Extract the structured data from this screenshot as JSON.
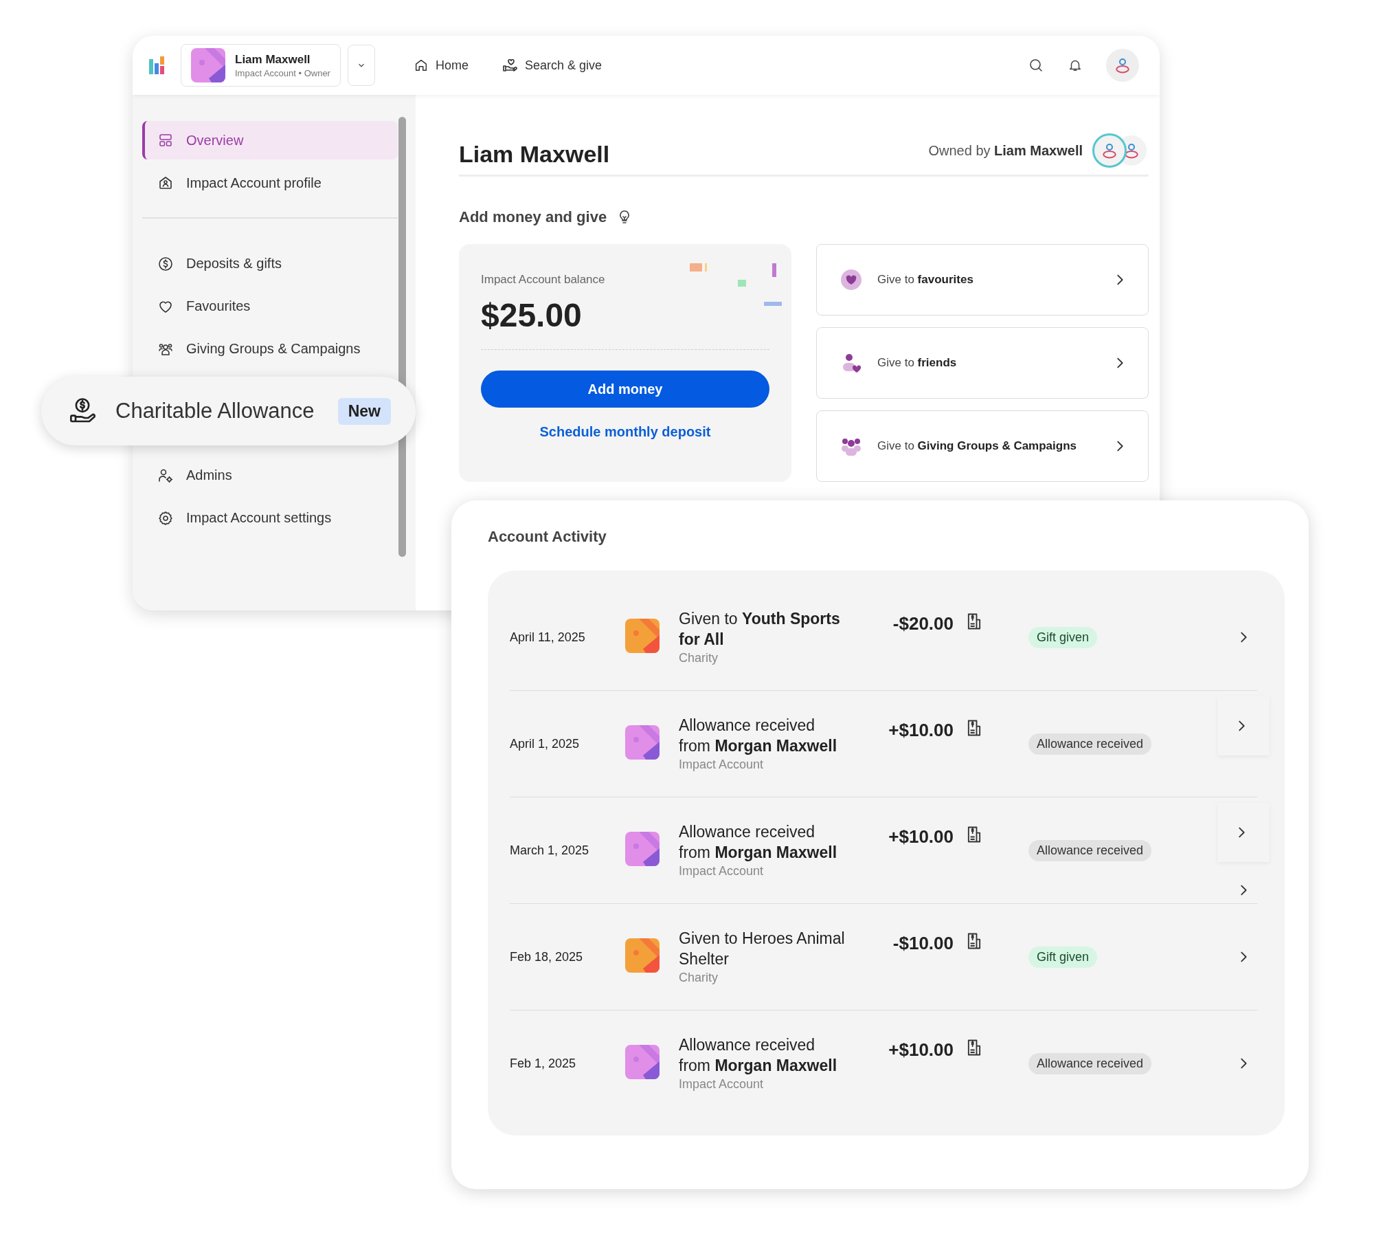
{
  "top_bar": {
    "account": {
      "name": "Liam Maxwell",
      "subtitle": "Impact Account • Owner"
    },
    "nav": [
      {
        "label": "Home"
      },
      {
        "label": "Search & give"
      }
    ]
  },
  "sidebar": {
    "sections": [
      {
        "items": [
          {
            "label": "Overview",
            "selected": true
          },
          {
            "label": "Impact Account profile",
            "selected": false
          }
        ]
      },
      {
        "divider_above": true,
        "items": [
          {
            "label": "Deposits & gifts",
            "selected": false
          },
          {
            "label": "Favourites",
            "selected": false
          },
          {
            "label": "Giving Groups & Campaigns",
            "selected": false
          }
        ]
      },
      {
        "divider_above": false,
        "items": [
          {
            "label": "Admins",
            "selected": false
          },
          {
            "label": "Impact Account settings",
            "selected": false
          }
        ]
      }
    ]
  },
  "highlight": {
    "label": "Charitable Allowance",
    "badge": "New"
  },
  "page": {
    "title": "Liam Maxwell",
    "owner": "Owned by **Liam Maxwell**",
    "section_title": "Add money and give",
    "balance": {
      "label": "Impact Account balance",
      "amount": "$25.00",
      "button": "Add money",
      "link": "Schedule monthly deposit"
    },
    "give_options": [
      {
        "text": "Give to **favourites**"
      },
      {
        "text": "Give to **friends**"
      },
      {
        "text": "Give to **Giving Groups & Campaigns**"
      }
    ]
  },
  "activity": {
    "title": "Account Activity",
    "rows": [
      {
        "kind": "charity",
        "date": "April 11, 2025",
        "title": "Given to **Youth Sports for All**",
        "subtitle": "Charity",
        "amount": "-$20.00",
        "status": "Gift given",
        "chevron_top": false,
        "chevron_center": true,
        "chevron_bottom": false
      },
      {
        "kind": "account",
        "date": "April 1, 2025",
        "title": "Allowance received from **Morgan Maxwell**",
        "subtitle": "Impact Account",
        "amount": "+$10.00",
        "status": "Allowance received",
        "chevron_top": true,
        "chevron_center": false,
        "chevron_bottom": false
      },
      {
        "kind": "account",
        "date": "March 1, 2025",
        "title": "Allowance received from **Morgan Maxwell**",
        "subtitle": "Impact Account",
        "amount": "+$10.00",
        "status": "Allowance received",
        "chevron_top": true,
        "chevron_center": false,
        "chevron_bottom": true
      },
      {
        "kind": "charity",
        "date": "Feb 18, 2025",
        "title": "Given to Heroes Animal Shelter",
        "subtitle": "Charity",
        "amount": "-$10.00",
        "status": "Gift given",
        "chevron_top": false,
        "chevron_center": true,
        "chevron_bottom": false
      },
      {
        "kind": "account",
        "date": "Feb 1, 2025",
        "title": "Allowance received from **Morgan Maxwell**",
        "subtitle": "Impact Account",
        "amount": "+$10.00",
        "status": "Allowance received",
        "chevron_top": false,
        "chevron_center": true,
        "chevron_bottom": false
      }
    ]
  }
}
